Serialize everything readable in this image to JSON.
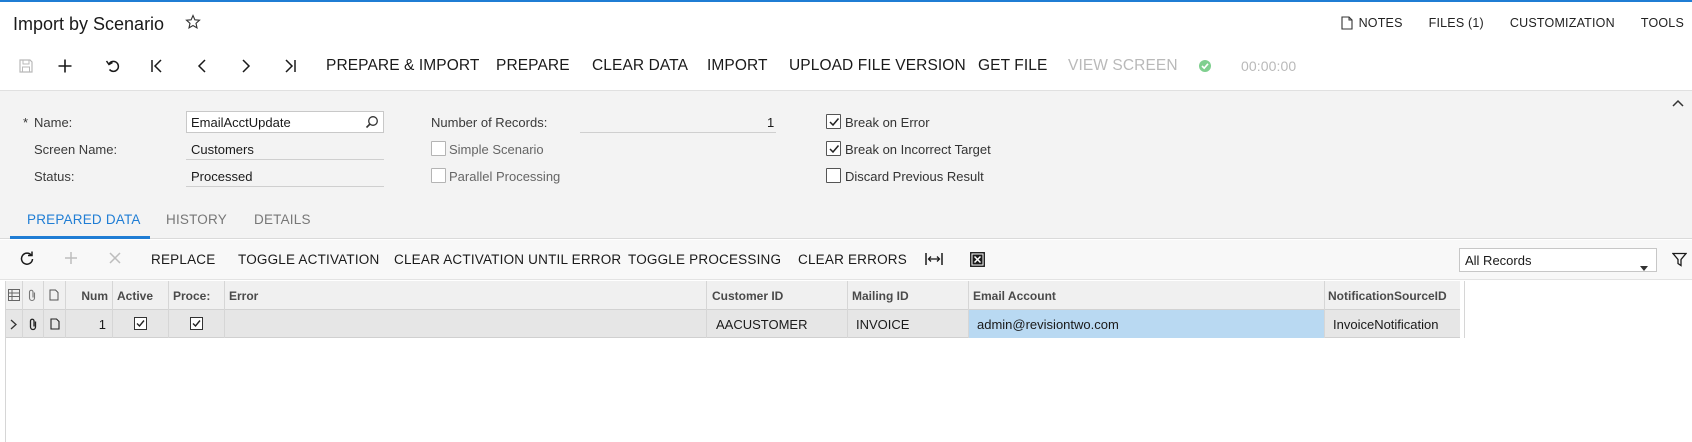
{
  "title": "Import by Scenario",
  "top_links": {
    "notes": "NOTES",
    "files": "FILES (1)",
    "customization": "CUSTOMIZATION",
    "tools": "TOOLS"
  },
  "toolbar": {
    "prepare_import": "PREPARE & IMPORT",
    "prepare": "PREPARE",
    "clear_data": "CLEAR DATA",
    "import": "IMPORT",
    "upload_file_version": "UPLOAD FILE VERSION",
    "get_file": "GET FILE",
    "view_screen": "VIEW SCREEN",
    "timer": "00:00:00"
  },
  "form": {
    "name_label": "Name:",
    "name_required_mark": "*",
    "name_value": "EmailAcctUpdate",
    "screen_name_label": "Screen Name:",
    "screen_name_value": "Customers",
    "status_label": "Status:",
    "status_value": "Processed",
    "number_of_records_label": "Number of Records:",
    "number_of_records_value": "1",
    "simple_scenario_label": "Simple Scenario",
    "simple_scenario_checked": false,
    "parallel_processing_label": "Parallel Processing",
    "parallel_processing_checked": false,
    "break_on_error_label": "Break on Error",
    "break_on_error_checked": true,
    "break_on_incorrect_target_label": "Break on Incorrect Target",
    "break_on_incorrect_target_checked": true,
    "discard_previous_result_label": "Discard Previous Result",
    "discard_previous_result_checked": false
  },
  "tabs": [
    {
      "label": "PREPARED DATA",
      "active": true
    },
    {
      "label": "HISTORY",
      "active": false
    },
    {
      "label": "DETAILS",
      "active": false
    }
  ],
  "grid_toolbar": {
    "replace": "REPLACE",
    "toggle_activation": "TOGGLE ACTIVATION",
    "clear_activation_until_error": "CLEAR ACTIVATION UNTIL ERROR",
    "toggle_processing": "TOGGLE PROCESSING",
    "clear_errors": "CLEAR ERRORS",
    "filter_select": "All Records"
  },
  "grid": {
    "columns": {
      "num": "Num",
      "active": "Active",
      "processed": "Proce:",
      "error": "Error",
      "customer_id": "Customer ID",
      "mailing_id": "Mailing ID",
      "email_account": "Email Account",
      "notification_source_id": "NotificationSourceID"
    },
    "rows": [
      {
        "num": "1",
        "active": true,
        "processed": true,
        "error": "",
        "customer_id": "AACUSTOMER",
        "mailing_id": "INVOICE",
        "email_account": "admin@revisiontwo.com",
        "notification_source_id": "InvoiceNotification"
      }
    ]
  },
  "colors": {
    "accent": "#1f7dd4",
    "selected_cell": "#b9d9f2",
    "status_ok": "#7fcf8f"
  }
}
